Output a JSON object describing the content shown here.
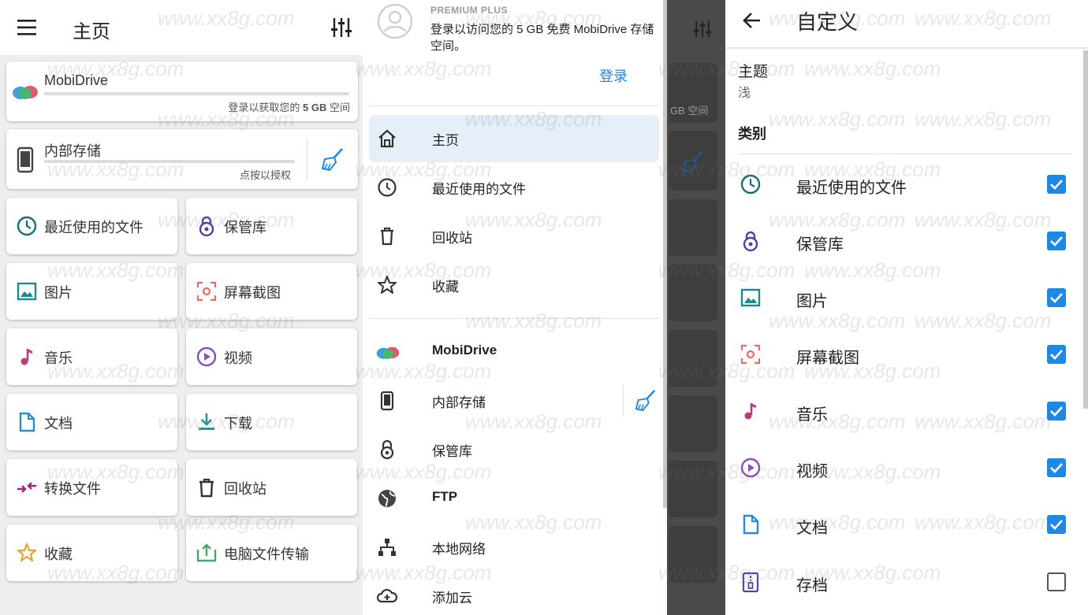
{
  "home": {
    "title": "主页",
    "mobidrive": {
      "name": "MobiDrive",
      "sub_prefix": "登录以获取您的 ",
      "sub_bold": "5 GB",
      "sub_suffix": " 空间"
    },
    "storage": {
      "name": "内部存储",
      "sub": "点按以授权"
    },
    "tiles": [
      {
        "label": "最近使用的文件",
        "icon": "clock-icon"
      },
      {
        "label": "保管库",
        "icon": "vault-icon"
      },
      {
        "label": "图片",
        "icon": "image-icon"
      },
      {
        "label": "屏幕截图",
        "icon": "screenshot-icon"
      },
      {
        "label": "音乐",
        "icon": "music-note-icon"
      },
      {
        "label": "视频",
        "icon": "play-circle-icon"
      },
      {
        "label": "文档",
        "icon": "document-icon"
      },
      {
        "label": "下载",
        "icon": "download-icon"
      },
      {
        "label": "转换文件",
        "icon": "convert-icon"
      },
      {
        "label": "回收站",
        "icon": "trash-icon"
      },
      {
        "label": "收藏",
        "icon": "star-icon"
      },
      {
        "label": "电脑文件传输",
        "icon": "pc-transfer-icon"
      }
    ]
  },
  "drawer": {
    "premium": "PREMIUM PLUS",
    "promo": "登录以访问您的 5 GB 免费 MobiDrive 存储空间。",
    "login": "登录",
    "items_top": [
      {
        "label": "主页",
        "icon": "home-icon",
        "active": true
      },
      {
        "label": "最近使用的文件",
        "icon": "clock-icon"
      },
      {
        "label": "回收站",
        "icon": "trash-icon"
      },
      {
        "label": "收藏",
        "icon": "star-icon"
      }
    ],
    "items_bottom": [
      {
        "label": "MobiDrive",
        "icon": "mobidrive-logo-icon",
        "bold": true
      },
      {
        "label": "内部存储",
        "icon": "phone-icon"
      },
      {
        "label": "保管库",
        "icon": "vault-icon"
      },
      {
        "label": "FTP",
        "icon": "globe-icon",
        "bold": true
      },
      {
        "label": "本地网络",
        "icon": "network-icon"
      },
      {
        "label": "添加云",
        "icon": "cloud-add-icon"
      }
    ],
    "bg_text": "GB 空间"
  },
  "customize": {
    "title": "自定义",
    "theme_label": "主题",
    "theme_value": "浅",
    "category_label": "类别",
    "rows": [
      {
        "label": "最近使用的文件",
        "icon": "clock-icon",
        "checked": true
      },
      {
        "label": "保管库",
        "icon": "vault-icon",
        "checked": true
      },
      {
        "label": "图片",
        "icon": "image-icon",
        "checked": true
      },
      {
        "label": "屏幕截图",
        "icon": "screenshot-icon",
        "checked": true
      },
      {
        "label": "音乐",
        "icon": "music-note-icon",
        "checked": true
      },
      {
        "label": "视频",
        "icon": "play-circle-icon",
        "checked": true
      },
      {
        "label": "文档",
        "icon": "document-icon",
        "checked": true
      },
      {
        "label": "存档",
        "icon": "archive-icon",
        "checked": false
      }
    ]
  },
  "watermark": "www.xx8g.com",
  "colors": {
    "accent": "#1e88e5",
    "teal": "#1a6e6e",
    "purple": "#5b3fa0",
    "pink": "#c0397a",
    "orange": "#e8a33a",
    "green": "#46a86a",
    "red": "#e86a6a"
  }
}
